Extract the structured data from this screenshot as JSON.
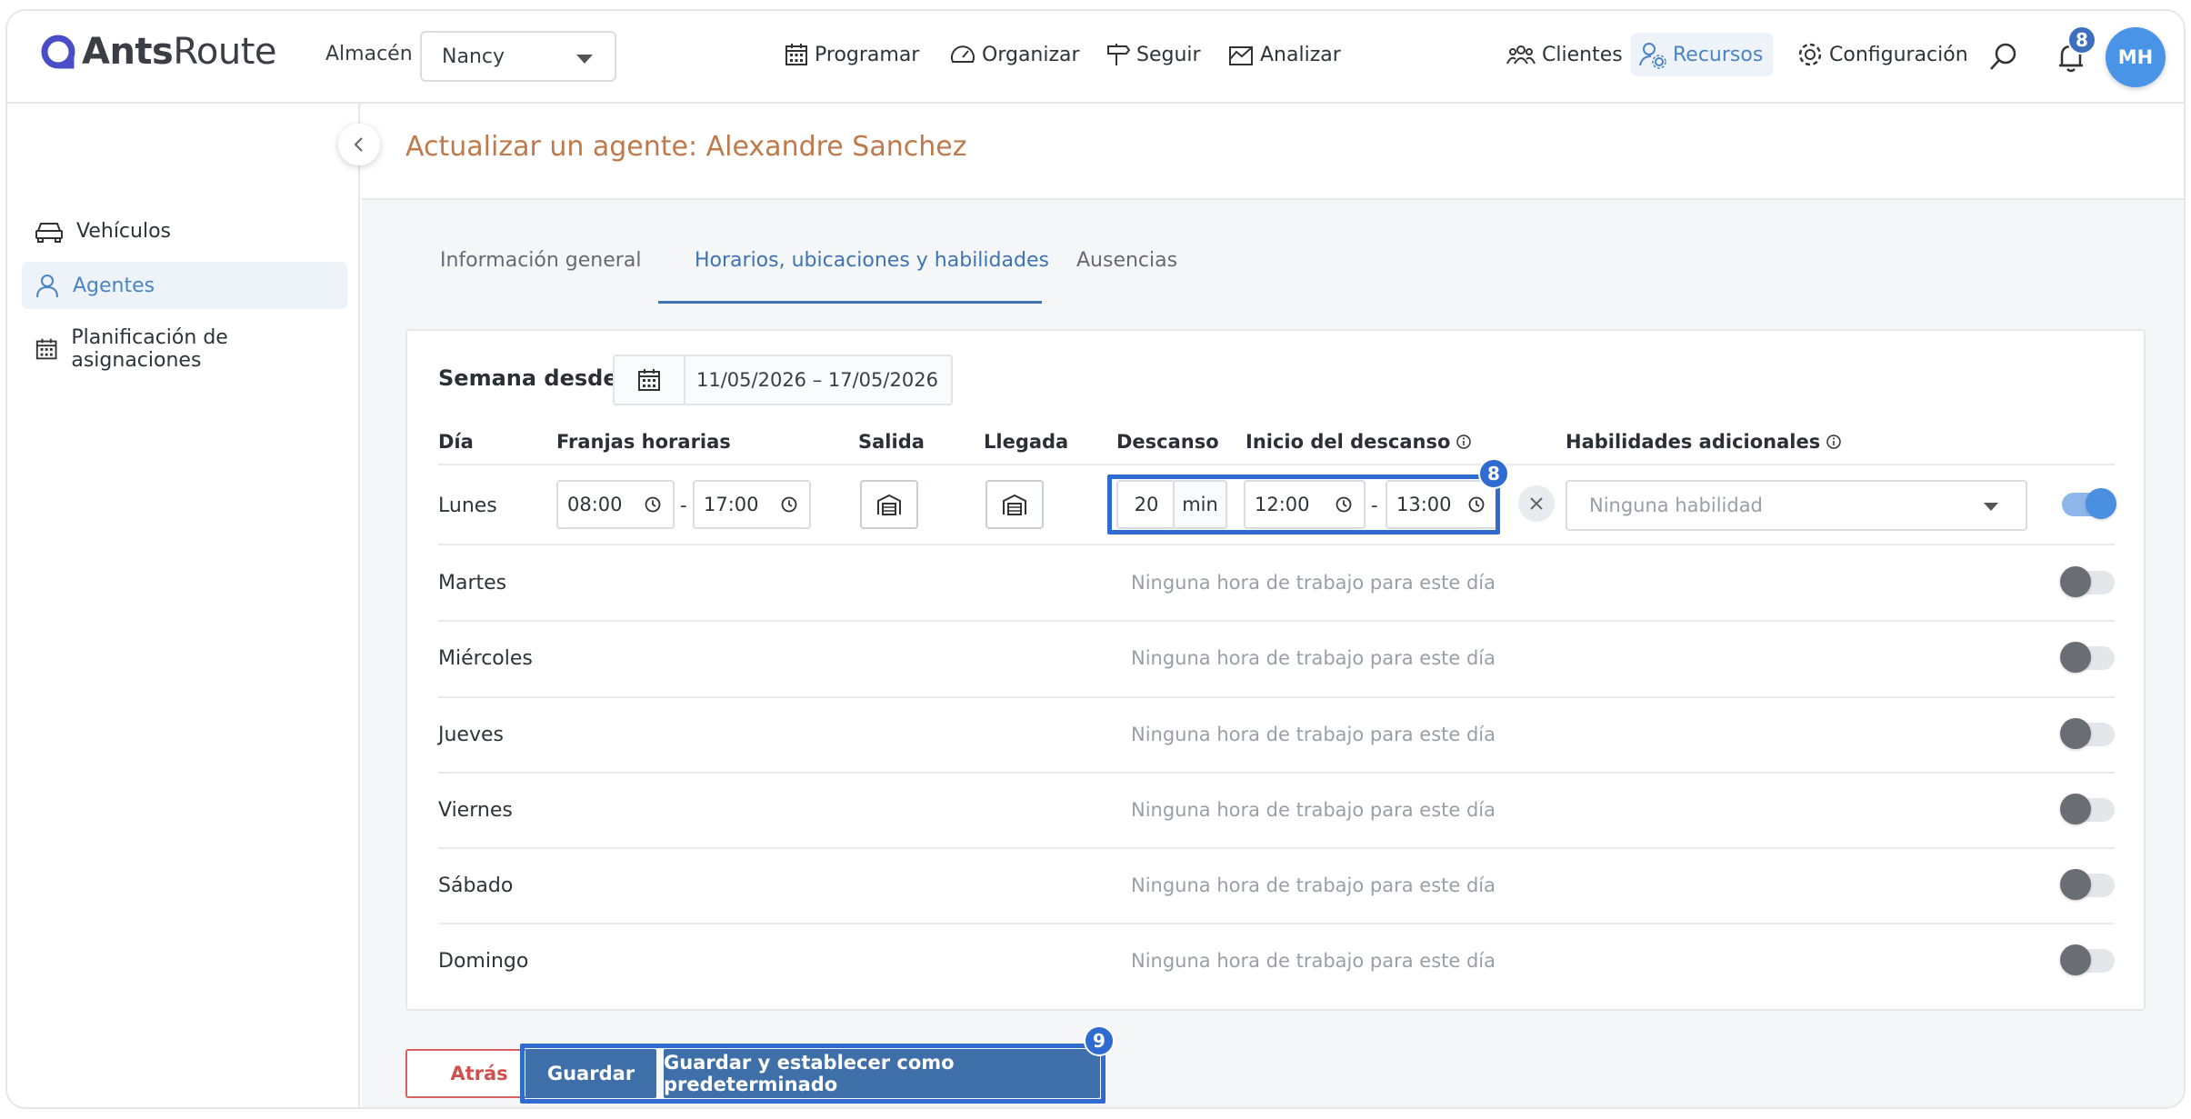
{
  "header": {
    "logo_bold": "Ants",
    "logo_light": "Route",
    "warehouse_label": "Almacén",
    "warehouse_value": "Nancy",
    "nav": [
      {
        "label": "Programar",
        "icon": "calendar-icon"
      },
      {
        "label": "Organizar",
        "icon": "gauge-icon"
      },
      {
        "label": "Seguir",
        "icon": "signpost-icon"
      },
      {
        "label": "Analizar",
        "icon": "chart-icon"
      },
      {
        "label": "Clientes",
        "icon": "users-icon"
      },
      {
        "label": "Recursos",
        "icon": "user-gear-icon"
      },
      {
        "label": "Configuración",
        "icon": "gear-icon"
      }
    ],
    "notification_count": "8",
    "avatar_initials": "MH"
  },
  "sidebar": {
    "items": [
      {
        "label": "Vehículos",
        "icon": "car-icon"
      },
      {
        "label": "Agentes",
        "icon": "person-icon"
      },
      {
        "label": "Planificación de asignaciones",
        "icon": "calendar-icon"
      }
    ]
  },
  "page": {
    "title": "Actualizar un agente: Alexandre Sanchez",
    "tabs": [
      "Información general",
      "Horarios, ubicaciones y habilidades",
      "Ausencias"
    ]
  },
  "schedule": {
    "week_label": "Semana desde",
    "week_range": "11/05/2026 – 17/05/2026",
    "headers": {
      "day": "Día",
      "slots": "Franjas horarias",
      "departure": "Salida",
      "arrival": "Llegada",
      "break": "Descanso",
      "break_start": "Inicio del descanso",
      "skills": "Habilidades adicionales"
    },
    "monday": {
      "day": "Lunes",
      "start": "08:00",
      "end": "17:00",
      "break_duration": "20",
      "break_unit": "min",
      "break_start": "12:00",
      "break_end": "13:00",
      "skills_placeholder": "Ninguna habilidad",
      "enabled": true
    },
    "off_days": [
      "Martes",
      "Miércoles",
      "Jueves",
      "Viernes",
      "Sábado",
      "Domingo"
    ],
    "no_work_text": "Ninguna hora de trabajo para este día",
    "separator": "-"
  },
  "annotations": {
    "break_badge": "8",
    "save_badge": "9"
  },
  "actions": {
    "back": "Atrás",
    "save": "Guardar",
    "save_default": "Guardar y establecer como predeterminado"
  },
  "colors": {
    "accent": "#3e73b6",
    "title": "#c0794a",
    "highlight": "#2f6bd0",
    "danger": "#d05050"
  }
}
